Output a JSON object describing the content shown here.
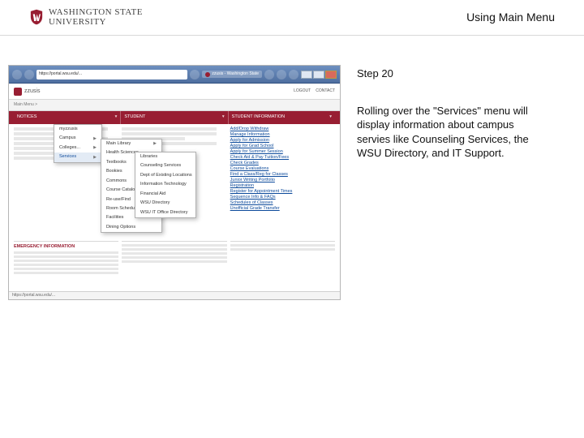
{
  "header": {
    "logo_line1": "WASHINGTON STATE",
    "logo_line2": "UNIVERSITY",
    "page_title": "Using Main Menu"
  },
  "caption": {
    "step_label": "Step 20",
    "paragraph": "Rolling over the \"Services\" menu will display information about campus servies like Counseling Services, the WSU Directory, and IT Support."
  },
  "browser": {
    "url": "https://portal.wsu.edu/...",
    "tab_label": "zzusis - Washington State",
    "window_buttons": [
      "minimize",
      "maximize",
      "close"
    ]
  },
  "zzusis": {
    "brand": "zzusis",
    "util_links": [
      "LOGOUT",
      "CONTACT"
    ],
    "nav_breadcrumb": "Main Menu >",
    "menu_bar": [
      "NOTICES",
      "STUDENT",
      "STUDENT INFORMATION"
    ],
    "right_links": [
      "Add/Drop Withdraw",
      "Manage Information",
      "Apply for Admission",
      "Apply for Grad School",
      "Apply for Summer Session",
      "Check Aid & Pay Tuition/Fees",
      "Check Grades",
      "Course Evaluations",
      "Find a Class/Reg for Classes",
      "Junior Writing Portfolio",
      "Registration",
      "Register for Appointment Times",
      "Sequence Info & FAQs",
      "Schedules of Classes",
      "Unofficial Grade Transfer"
    ],
    "dropdown1": {
      "items": [
        "myzzusis",
        "Campus",
        "Colleges...",
        "Services"
      ],
      "highlighted": "Services"
    },
    "dropdown2": {
      "items": [
        "Main Library",
        "Health Sciences",
        "",
        "Textbooks",
        "Bookies",
        "Commons",
        "Course Catalog",
        "Re-use/Find",
        "Room Scheduling",
        "Facilities",
        "Dining Options"
      ]
    },
    "dropdown3": {
      "items": [
        "Libraries",
        "Counseling Services",
        "Dept of Existing Locations",
        "",
        "Information Technology",
        "Financial Aid",
        "",
        "WSU Directory",
        "WSU IT Office Directory"
      ]
    },
    "emergency_title": "EMERGENCY INFORMATION",
    "status_bar": "https://portal.wsu.edu/..."
  }
}
